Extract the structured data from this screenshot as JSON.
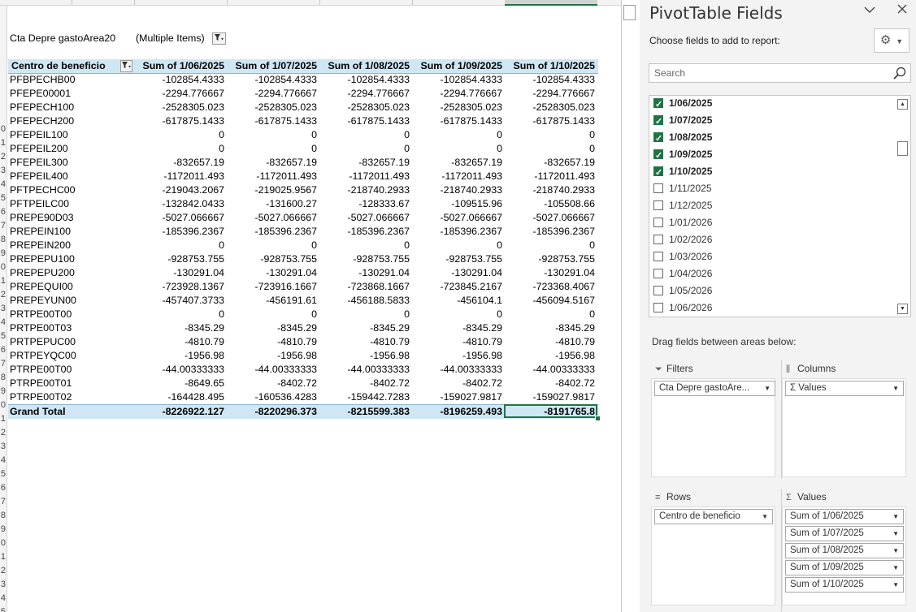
{
  "filter": {
    "field_label": "Cta Depre gastoArea20",
    "value": "(Multiple Items)"
  },
  "pivot": {
    "headers": [
      "Centro de beneficio",
      "Sum of 1/06/2025",
      "Sum of 1/07/2025",
      "Sum of 1/08/2025",
      "Sum of 1/09/2025",
      "Sum of 1/10/2025"
    ],
    "rows": [
      {
        "label": "PFBPECHB00",
        "v": [
          "-102854.4333",
          "-102854.4333",
          "-102854.4333",
          "-102854.4333",
          "-102854.4333"
        ]
      },
      {
        "label": "PFEPE00001",
        "v": [
          "-2294.776667",
          "-2294.776667",
          "-2294.776667",
          "-2294.776667",
          "-2294.776667"
        ]
      },
      {
        "label": "PFEPECH100",
        "v": [
          "-2528305.023",
          "-2528305.023",
          "-2528305.023",
          "-2528305.023",
          "-2528305.023"
        ]
      },
      {
        "label": "PFEPECH200",
        "v": [
          "-617875.1433",
          "-617875.1433",
          "-617875.1433",
          "-617875.1433",
          "-617875.1433"
        ]
      },
      {
        "label": "PFEPEIL100",
        "v": [
          "0",
          "0",
          "0",
          "0",
          "0"
        ]
      },
      {
        "label": "PFEPEIL200",
        "v": [
          "0",
          "0",
          "0",
          "0",
          "0"
        ]
      },
      {
        "label": "PFEPEIL300",
        "v": [
          "-832657.19",
          "-832657.19",
          "-832657.19",
          "-832657.19",
          "-832657.19"
        ]
      },
      {
        "label": "PFEPEIL400",
        "v": [
          "-1172011.493",
          "-1172011.493",
          "-1172011.493",
          "-1172011.493",
          "-1172011.493"
        ]
      },
      {
        "label": "PFTPECHC00",
        "v": [
          "-219043.2067",
          "-219025.9567",
          "-218740.2933",
          "-218740.2933",
          "-218740.2933"
        ]
      },
      {
        "label": "PFTPEILC00",
        "v": [
          "-132842.0433",
          "-131600.27",
          "-128333.67",
          "-109515.96",
          "-105508.66"
        ]
      },
      {
        "label": "PREPE90D03",
        "v": [
          "-5027.066667",
          "-5027.066667",
          "-5027.066667",
          "-5027.066667",
          "-5027.066667"
        ]
      },
      {
        "label": "PREPEIN100",
        "v": [
          "-185396.2367",
          "-185396.2367",
          "-185396.2367",
          "-185396.2367",
          "-185396.2367"
        ]
      },
      {
        "label": "PREPEIN200",
        "v": [
          "0",
          "0",
          "0",
          "0",
          "0"
        ]
      },
      {
        "label": "PREPEPU100",
        "v": [
          "-928753.755",
          "-928753.755",
          "-928753.755",
          "-928753.755",
          "-928753.755"
        ]
      },
      {
        "label": "PREPEPU200",
        "v": [
          "-130291.04",
          "-130291.04",
          "-130291.04",
          "-130291.04",
          "-130291.04"
        ]
      },
      {
        "label": "PREPEQUI00",
        "v": [
          "-723928.1367",
          "-723916.1667",
          "-723868.1667",
          "-723845.2167",
          "-723368.4067"
        ]
      },
      {
        "label": "PREPEYUN00",
        "v": [
          "-457407.3733",
          "-456191.61",
          "-456188.5833",
          "-456104.1",
          "-456094.5167"
        ]
      },
      {
        "label": "PRTPE00T00",
        "v": [
          "0",
          "0",
          "0",
          "0",
          "0"
        ]
      },
      {
        "label": "PRTPE00T03",
        "v": [
          "-8345.29",
          "-8345.29",
          "-8345.29",
          "-8345.29",
          "-8345.29"
        ]
      },
      {
        "label": "PRTPEPUC00",
        "v": [
          "-4810.79",
          "-4810.79",
          "-4810.79",
          "-4810.79",
          "-4810.79"
        ]
      },
      {
        "label": "PRTPEYQC00",
        "v": [
          "-1956.98",
          "-1956.98",
          "-1956.98",
          "-1956.98",
          "-1956.98"
        ]
      },
      {
        "label": "PTRPE00T00",
        "v": [
          "-44.00333333",
          "-44.00333333",
          "-44.00333333",
          "-44.00333333",
          "-44.00333333"
        ]
      },
      {
        "label": "PTRPE00T01",
        "v": [
          "-8649.65",
          "-8402.72",
          "-8402.72",
          "-8402.72",
          "-8402.72"
        ]
      },
      {
        "label": "PTRPE00T02",
        "v": [
          "-164428.495",
          "-160536.4283",
          "-159442.7283",
          "-159027.9817",
          "-159027.9817"
        ]
      }
    ],
    "grand_total": {
      "label": "Grand Total",
      "v": [
        "-8226922.127",
        "-8220296.373",
        "-8215599.383",
        "-8196259.493",
        "-8191765.8"
      ]
    }
  },
  "row_numbers": [
    "",
    "",
    "",
    "",
    "",
    "0",
    "1",
    "2",
    "3",
    "4",
    "5",
    "6",
    "7",
    "8",
    "9",
    "0",
    "1",
    "2",
    "3",
    "4",
    "5",
    "6",
    "7",
    "8",
    "9",
    "0",
    "1",
    "2",
    "3",
    "4",
    "5",
    "6",
    "7",
    "8",
    "9",
    "0",
    "1",
    "2",
    "3",
    "4",
    "5",
    "6"
  ],
  "pane": {
    "title": "PivotTable Fields",
    "choose_label": "Choose fields to add to report:",
    "search_placeholder": "Search",
    "fields": [
      {
        "label": "1/06/2025",
        "checked": true
      },
      {
        "label": "1/07/2025",
        "checked": true
      },
      {
        "label": "1/08/2025",
        "checked": true
      },
      {
        "label": "1/09/2025",
        "checked": true
      },
      {
        "label": "1/10/2025",
        "checked": true
      },
      {
        "label": "1/11/2025",
        "checked": false
      },
      {
        "label": "1/12/2025",
        "checked": false
      },
      {
        "label": "1/01/2026",
        "checked": false
      },
      {
        "label": "1/02/2026",
        "checked": false
      },
      {
        "label": "1/03/2026",
        "checked": false
      },
      {
        "label": "1/04/2026",
        "checked": false
      },
      {
        "label": "1/05/2026",
        "checked": false
      },
      {
        "label": "1/06/2026",
        "checked": false
      }
    ],
    "drag_label": "Drag fields between areas below:",
    "areas": {
      "filters": {
        "title": "Filters",
        "icon": "filter-icon",
        "chips": [
          "Cta Depre gastoAre..."
        ]
      },
      "columns": {
        "title": "Columns",
        "icon": "columns-icon",
        "chips": [
          "Σ  Values"
        ]
      },
      "rows": {
        "title": "Rows",
        "icon": "rows-icon",
        "chips": [
          "Centro de beneficio"
        ]
      },
      "values": {
        "title": "Values",
        "icon": "sigma-icon",
        "chips": [
          "Sum of 1/06/2025",
          "Sum of 1/07/2025",
          "Sum of 1/08/2025",
          "Sum of 1/09/2025",
          "Sum of 1/10/2025"
        ]
      }
    }
  },
  "colors": {
    "accent": "#217346",
    "header_fill": "#cfe7f5"
  }
}
